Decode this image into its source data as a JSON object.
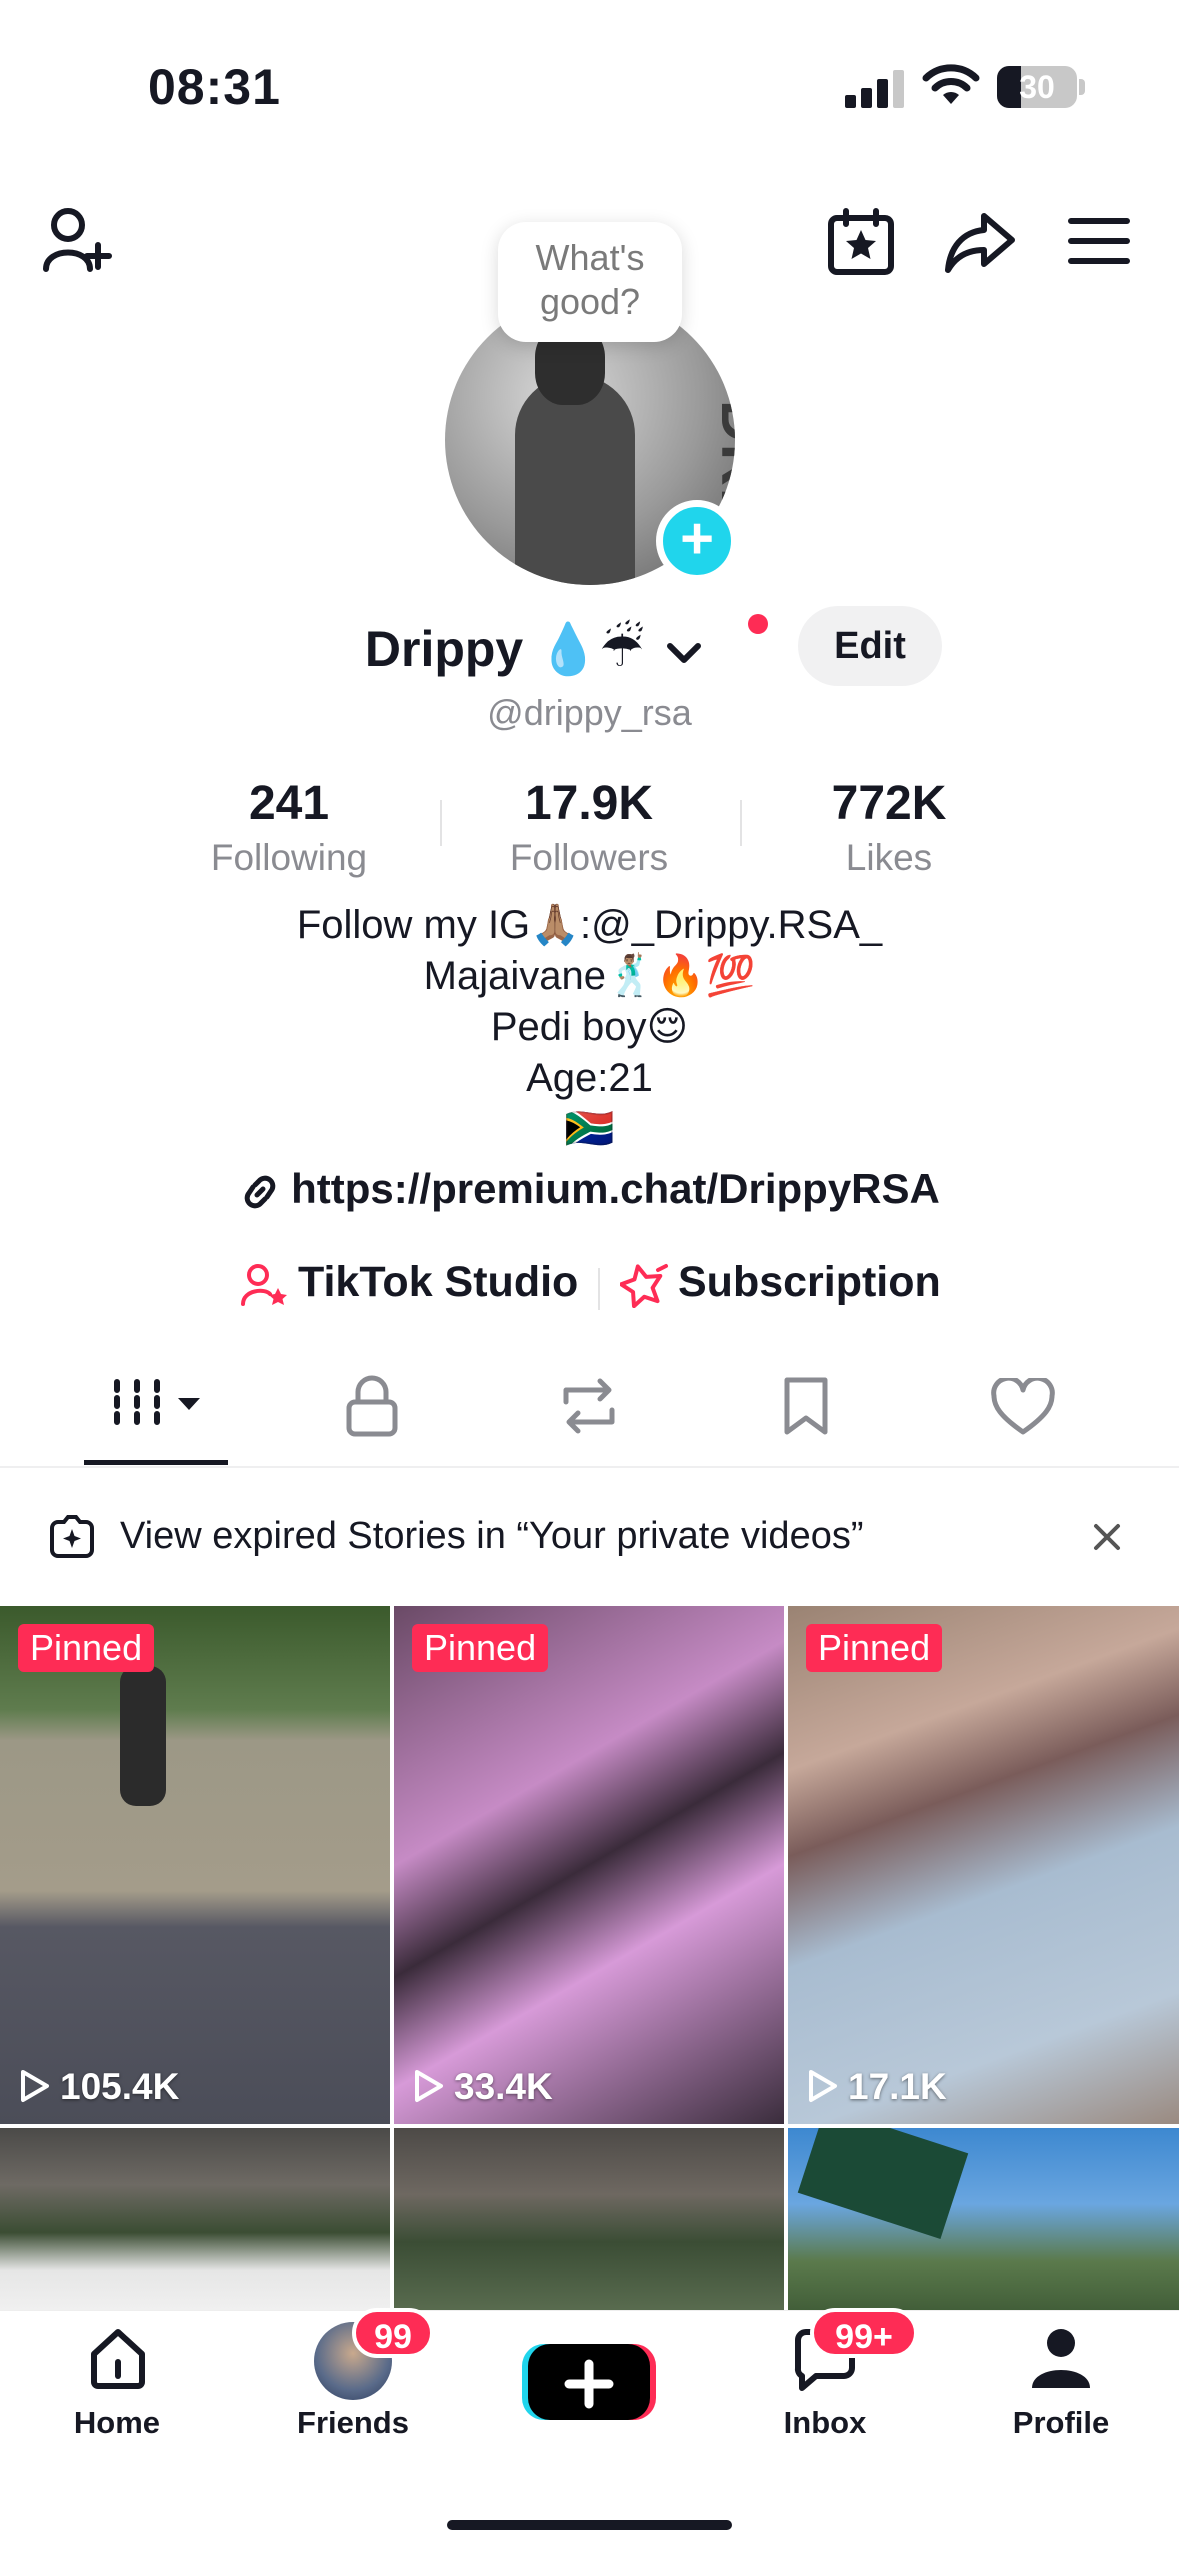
{
  "status_bar": {
    "time": "08:31",
    "battery_level": "30"
  },
  "profile": {
    "bubble_text": "What's good?",
    "name": "Drippy 💧☔",
    "edit_label": "Edit",
    "handle": "@drippy_rsa",
    "avatar_text": "DRIPPY",
    "stats": [
      {
        "value": "241",
        "label": "Following"
      },
      {
        "value": "17.9K",
        "label": "Followers"
      },
      {
        "value": "772K",
        "label": "Likes"
      }
    ],
    "bio": [
      "Follow my IG🙏🏽:@_Drippy.RSA_",
      "Majaivane🕺🏽🔥💯",
      "Pedi boy😌",
      "Age:21",
      "🇿🇦"
    ],
    "link": "https://premium.chat/DrippyRSA",
    "studio_label": "TikTok Studio",
    "subscription_label": "Subscription"
  },
  "banner": {
    "text": "View expired Stories in “Your private videos”"
  },
  "videos": [
    {
      "pinned": "Pinned",
      "views": "105.4K"
    },
    {
      "pinned": "Pinned",
      "views": "33.4K"
    },
    {
      "pinned": "Pinned",
      "views": "17.1K"
    },
    {
      "pinned": "",
      "views": ""
    },
    {
      "pinned": "",
      "views": ""
    },
    {
      "pinned": "",
      "views": ""
    }
  ],
  "nav": {
    "home": "Home",
    "friends": "Friends",
    "friends_badge": "99",
    "inbox": "Inbox",
    "inbox_badge": "99+",
    "profile": "Profile"
  },
  "colors": {
    "accent": "#fe2c55",
    "cyan": "#20d5ec",
    "text": "#161823",
    "muted": "#8a8b91"
  }
}
